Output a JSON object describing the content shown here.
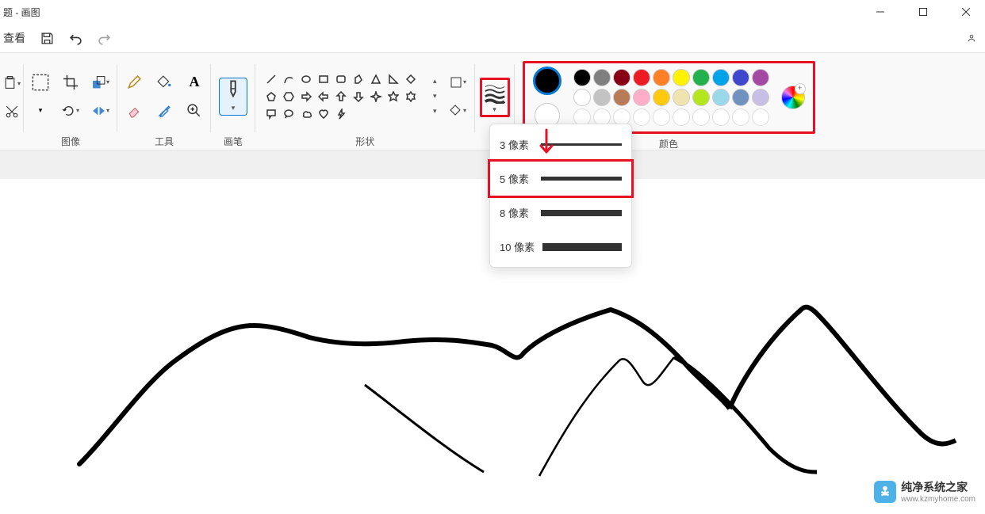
{
  "window": {
    "title": "题 - 画图"
  },
  "quickbar": {
    "view": "查看"
  },
  "ribbon": {
    "groups": {
      "image": "图像",
      "tools": "工具",
      "brushes": "画笔",
      "shapes": "形状",
      "colors": "颜色"
    }
  },
  "size_menu": {
    "items": [
      {
        "label": "3 像素",
        "thickness": 3
      },
      {
        "label": "5 像素",
        "thickness": 5
      },
      {
        "label": "8 像素",
        "thickness": 8
      },
      {
        "label": "10 像素",
        "thickness": 10
      }
    ]
  },
  "colors": {
    "primary": "#000000",
    "secondary": "#ffffff",
    "palette_row1": [
      "#000000",
      "#7f7f7f",
      "#880015",
      "#ed1c24",
      "#ff7f27",
      "#fff200",
      "#22b14c",
      "#00a2e8",
      "#3f48cc",
      "#a349a4"
    ],
    "palette_row2": [
      "#ffffff",
      "#c3c3c3",
      "#b97a57",
      "#ffaec9",
      "#ffc90e",
      "#efe4b0",
      "#b5e61d",
      "#99d9ea",
      "#7092be",
      "#c8bfe7"
    ],
    "palette_row3": [
      "#ffffff",
      "#ffffff",
      "#ffffff",
      "#ffffff",
      "#ffffff",
      "#ffffff",
      "#ffffff",
      "#ffffff",
      "#ffffff",
      "#ffffff"
    ]
  },
  "watermark": {
    "title": "纯净系统之家",
    "url": "www.kzmyhome.com"
  }
}
